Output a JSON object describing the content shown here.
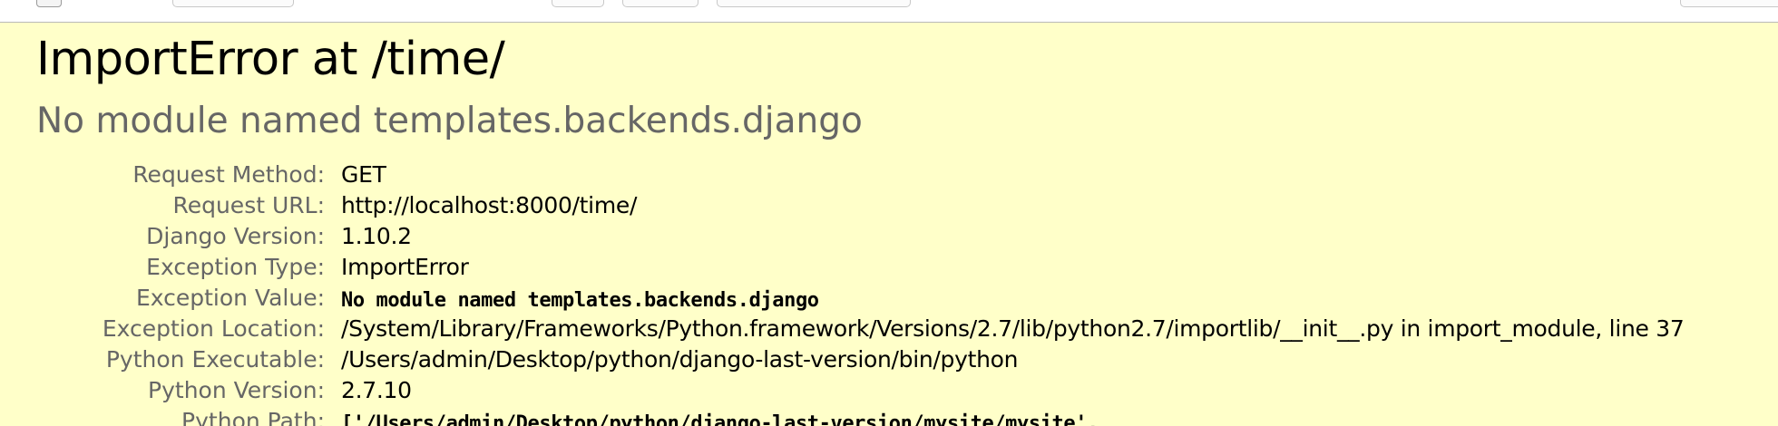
{
  "error": {
    "title": "ImportError at /time/",
    "message": "No module named templates.backends.django"
  },
  "meta_rows": [
    {
      "label": "Request Method:",
      "value": "GET"
    },
    {
      "label": "Request URL:",
      "value": "http://localhost:8000/time/"
    },
    {
      "label": "Django Version:",
      "value": "1.10.2"
    },
    {
      "label": "Exception Type:",
      "value": "ImportError"
    },
    {
      "label": "Exception Value:",
      "value": "No module named templates.backends.django"
    },
    {
      "label": "Exception Location:",
      "value": "/System/Library/Frameworks/Python.framework/Versions/2.7/lib/python2.7/importlib/__init__.py in import_module, line 37"
    },
    {
      "label": "Python Executable:",
      "value": "/Users/admin/Desktop/python/django-last-version/bin/python"
    },
    {
      "label": "Python Version:",
      "value": "2.7.10"
    },
    {
      "label": "Python Path:",
      "value": "['/Users/admin/Desktop/python/django-last-version/mysite/mysite',"
    }
  ],
  "colors": {
    "background": "#ffffc9",
    "label": "#666666",
    "heading": "#000000",
    "subheading": "#666666"
  }
}
